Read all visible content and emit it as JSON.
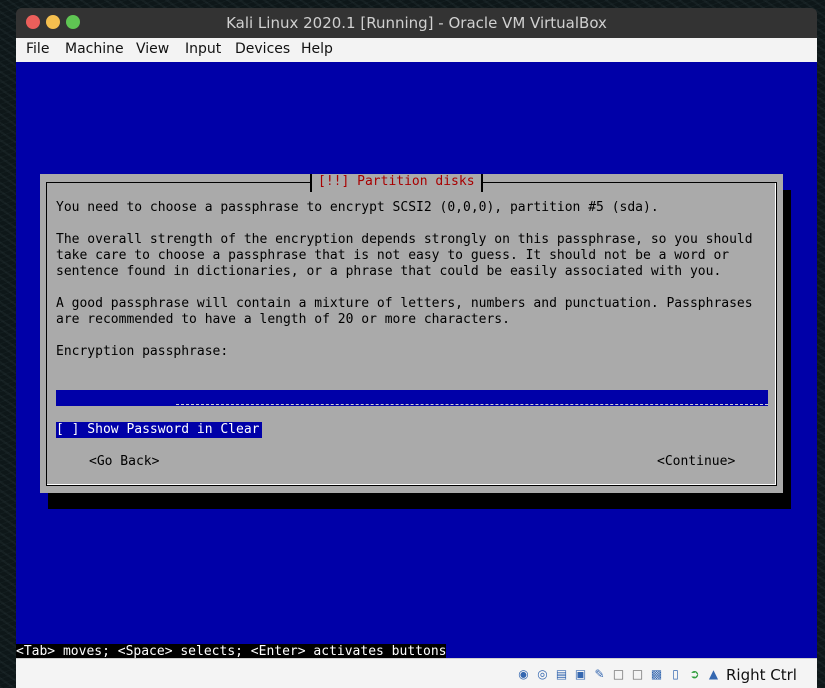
{
  "window": {
    "title": "Kali Linux 2020.1 [Running] - Oracle VM VirtualBox"
  },
  "menubar": {
    "items": [
      "File",
      "Machine",
      "View",
      "Input",
      "Devices",
      "Help"
    ]
  },
  "dialog": {
    "title": "[!!] Partition disks",
    "line1": "You need to choose a passphrase to encrypt SCSI2 (0,0,0), partition #5 (sda).",
    "para2": [
      "The overall strength of the encryption depends strongly on this passphrase, so you should",
      "take care to choose a passphrase that is not easy to guess. It should not be a word or",
      "sentence found in dictionaries, or a phrase that could be easily associated with you."
    ],
    "para3": [
      "A good passphrase will contain a mixture of letters, numbers and punctuation. Passphrases",
      "are recommended to have a length of 20 or more characters."
    ],
    "field_label": "Encryption passphrase:",
    "field_value": "**************",
    "checkbox_label": "[ ] Show Password in Clear",
    "go_back": "<Go Back>",
    "continue": "<Continue>"
  },
  "status_line": "<Tab> moves; <Space> selects; <Enter> activates buttons",
  "statusbar": {
    "icons": [
      "hard-disk-icon",
      "optical-drive-icon",
      "usb-icon",
      "shared-folder-icon",
      "pencil-icon",
      "display-icon",
      "network-icon",
      "video-capture-icon",
      "arrow-icon",
      "mouse-icon"
    ],
    "host_key": "Right Ctrl"
  }
}
